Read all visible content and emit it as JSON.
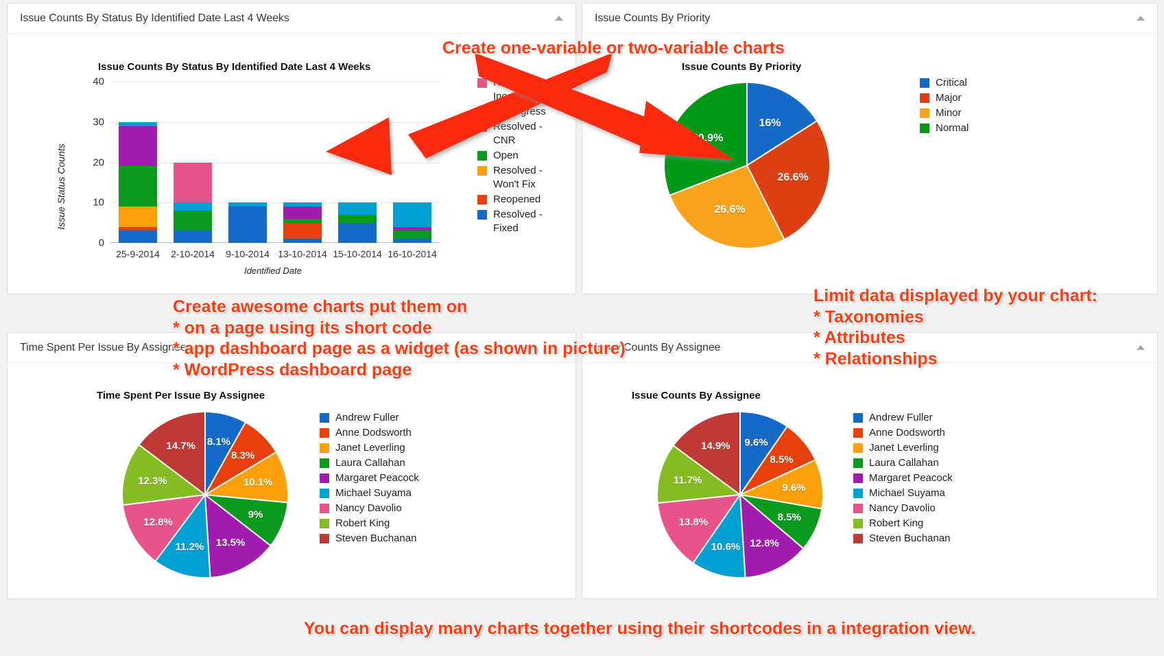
{
  "colors": {
    "blue": "#1569c7",
    "orange_red": "#e8400c",
    "amber": "#fba00b",
    "green": "#0a9b1e",
    "purple": "#a21caf",
    "cyan": "#00a0d2",
    "pink": "#e8548a",
    "olive": "#84bc22",
    "brick": "#bf3a36",
    "priority_blue": "#1569c7",
    "priority_red": "#dd4014",
    "priority_amber": "#f9a21b",
    "priority_green": "#009a17",
    "annotation_red": "#ff3b11"
  },
  "panels": {
    "top_left": {
      "title": "Issue Counts By Status By Identified Date Last 4 Weeks",
      "collapse_icon": "caret-up-icon"
    },
    "top_right": {
      "title": "Issue Counts By Priority",
      "collapse_icon": "caret-up-icon"
    },
    "bottom_left": {
      "title": "Time Spent Per Issue By Assignee",
      "collapse_icon": "caret-up-icon"
    },
    "bottom_right": {
      "title": "Issue Counts By Assignee",
      "collapse_icon": "caret-up-icon"
    }
  },
  "annotations": {
    "top": "Create one-variable or two-variable charts",
    "left_block": "Create awesome charts put them on\n* on a page using its short code\n* app dashboard page as a widget (as shown in picture)\n* WordPress dashboard page",
    "right_block": "Limit data displayed by your chart:\n* Taxonomies\n* Attributes\n* Relationships",
    "bottom": "You can display many charts together using their shortcodes in a integration view."
  },
  "chart_data": [
    {
      "id": "issue-counts-by-status-by-identified-date",
      "type": "bar",
      "stacked": true,
      "title": "Issue Counts By Status By Identified Date Last 4 Weeks",
      "xlabel": "Identified Date",
      "ylabel": "Issue Status Counts",
      "ylim": [
        0,
        40
      ],
      "yticks": [
        0,
        10,
        20,
        30,
        40
      ],
      "grid": true,
      "legend_position": "right",
      "categories": [
        "25-9-2014",
        "2-10-2014",
        "9-10-2014",
        "13-10-2014",
        "15-10-2014",
        "16-10-2014"
      ],
      "series": [
        {
          "name": "Resolved -\nIncomplete",
          "color": "#e8548a",
          "values": [
            0,
            10,
            0,
            0,
            0,
            0
          ]
        },
        {
          "name": "In Progress",
          "color": "#00a0d2",
          "values": [
            1,
            2,
            1,
            1,
            3,
            6
          ]
        },
        {
          "name": "Resolved -\nCNR",
          "color": "#a21caf",
          "values": [
            10,
            0,
            0,
            3,
            0,
            1
          ]
        },
        {
          "name": "Open",
          "color": "#0a9b1e",
          "values": [
            10,
            5,
            0,
            1,
            2,
            2
          ]
        },
        {
          "name": "Resolved -\nWon't Fix",
          "color": "#fba00b",
          "values": [
            5,
            0,
            0,
            0,
            0,
            0
          ]
        },
        {
          "name": "Reopened",
          "color": "#e8400c",
          "values": [
            1,
            0,
            0,
            4,
            0,
            0
          ]
        },
        {
          "name": "Resolved -\nFixed",
          "color": "#1569c7",
          "values": [
            3,
            3,
            9,
            1,
            5,
            1
          ]
        }
      ],
      "totals": [
        30,
        20,
        10,
        10,
        10,
        14
      ]
    },
    {
      "id": "issue-counts-by-priority",
      "type": "pie",
      "title": "Issue Counts By Priority",
      "legend_position": "right",
      "labels": [
        "Critical",
        "Major",
        "Minor",
        "Normal"
      ],
      "values": [
        16,
        26.6,
        26.6,
        30.9
      ],
      "display_values": [
        "16%",
        "26.6%",
        "26.6%",
        "30.9%"
      ],
      "colors": [
        "#1569c7",
        "#dd4014",
        "#f9a21b",
        "#009a17"
      ]
    },
    {
      "id": "time-spent-per-issue-by-assignee",
      "type": "pie",
      "title": "Time Spent Per Issue By Assignee",
      "legend_position": "right",
      "labels": [
        "Andrew Fuller",
        "Anne Dodsworth",
        "Janet Leverling",
        "Laura Callahan",
        "Margaret Peacock",
        "Michael Suyama",
        "Nancy Davolio",
        "Robert King",
        "Steven Buchanan"
      ],
      "values": [
        8.1,
        8.3,
        10.1,
        9,
        13.5,
        11.2,
        12.8,
        12.3,
        14.7
      ],
      "display_values": [
        "8.1%",
        "8.3%",
        "10.1%",
        "9%",
        "13.5%",
        "11.2%",
        "12.8%",
        "12.3%",
        "14.7%"
      ],
      "colors": [
        "#1569c7",
        "#e8400c",
        "#fba00b",
        "#0a9b1e",
        "#a21caf",
        "#00a0d2",
        "#e8548a",
        "#84bc22",
        "#bf3a36"
      ]
    },
    {
      "id": "issue-counts-by-assignee",
      "type": "pie",
      "title": "Issue Counts By Assignee",
      "legend_position": "right",
      "labels": [
        "Andrew Fuller",
        "Anne Dodsworth",
        "Janet Leverling",
        "Laura Callahan",
        "Margaret Peacock",
        "Michael Suyama",
        "Nancy Davolio",
        "Robert King",
        "Steven Buchanan"
      ],
      "values": [
        9.6,
        8.5,
        9.6,
        8.5,
        12.8,
        10.6,
        13.8,
        11.7,
        14.9
      ],
      "display_values": [
        "9.6%",
        "8.5%",
        "9.6%",
        "8.5%",
        "12.8%",
        "10.6%",
        "13.8%",
        "11.7%",
        "14.9%"
      ],
      "colors": [
        "#1569c7",
        "#e8400c",
        "#fba00b",
        "#0a9b1e",
        "#a21caf",
        "#00a0d2",
        "#e8548a",
        "#84bc22",
        "#bf3a36"
      ]
    }
  ]
}
